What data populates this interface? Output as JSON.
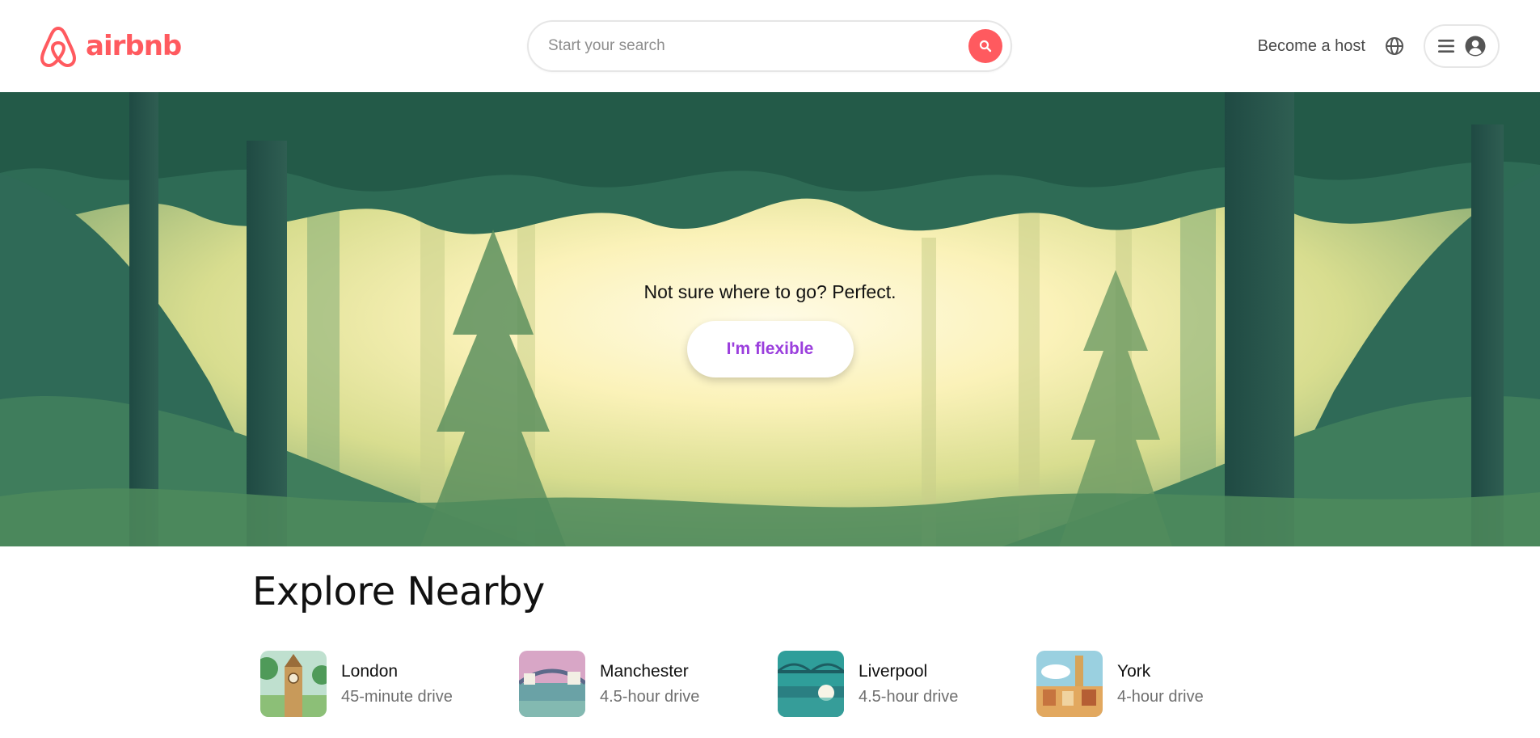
{
  "brand": {
    "name": "airbnb",
    "color": "#FF5A5F",
    "icon": "airbnb-logo-icon"
  },
  "search": {
    "placeholder": "Start your search",
    "icon": "search-icon"
  },
  "nav": {
    "host_label": "Become a host",
    "globe_icon": "globe-icon",
    "menu_icon": "hamburger-icon",
    "user_icon": "user-avatar-icon"
  },
  "hero": {
    "tagline": "Not sure where to go? Perfect.",
    "button_label": "I'm flexible",
    "button_color": "#9b3fdd"
  },
  "explore": {
    "title": "Explore Nearby",
    "places": [
      {
        "name": "London",
        "drive": "45-minute drive"
      },
      {
        "name": "Manchester",
        "drive": "4.5-hour drive"
      },
      {
        "name": "Liverpool",
        "drive": "4.5-hour drive"
      },
      {
        "name": "York",
        "drive": "4-hour drive"
      }
    ]
  }
}
